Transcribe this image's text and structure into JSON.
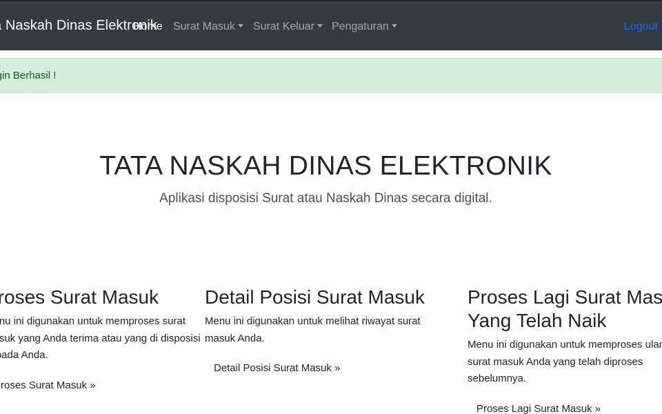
{
  "navbar": {
    "brand": "Tata Naskah Dinas Elektronik",
    "items": [
      {
        "label": "Home",
        "active": true
      },
      {
        "label": "Surat Masuk",
        "dropdown": true
      },
      {
        "label": "Surat Keluar",
        "dropdown": true
      },
      {
        "label": "Pengaturan",
        "dropdown": true
      }
    ],
    "logout": "Logout"
  },
  "alert": {
    "text": "Login Berhasil !"
  },
  "hero": {
    "title": "TATA NASKAH DINAS ELEKTRONIK",
    "lead": "Aplikasi disposisi Surat atau Naskah Dinas secara digital."
  },
  "cards": [
    {
      "title": "Proses Surat Masuk",
      "desc": [
        "Menu ini digunakan untuk memproses surat",
        "masuk yang Anda terima atau yang di disposisi",
        "kepada Anda."
      ],
      "link": "Proses Surat Masuk »"
    },
    {
      "title": "Detail Posisi Surat Masuk",
      "desc": [
        "Menu ini digunakan untuk melihat riwayat surat",
        "masuk Anda."
      ],
      "link": "Detail Posisi Surat Masuk »"
    },
    {
      "title": [
        "Proses Lagi Surat Masuk",
        "Yang Telah Naik"
      ],
      "desc": [
        "Menu ini digunakan untuk memproses ulang",
        "surat masuk Anda yang telah diproses",
        "sebelumnya."
      ],
      "link": "Proses Lagi Surat Masuk »"
    }
  ],
  "colors": {
    "navbar": "#343a40",
    "alert_bg": "#d4edda",
    "alert_text": "#155724",
    "logout": "#0d6efd"
  }
}
